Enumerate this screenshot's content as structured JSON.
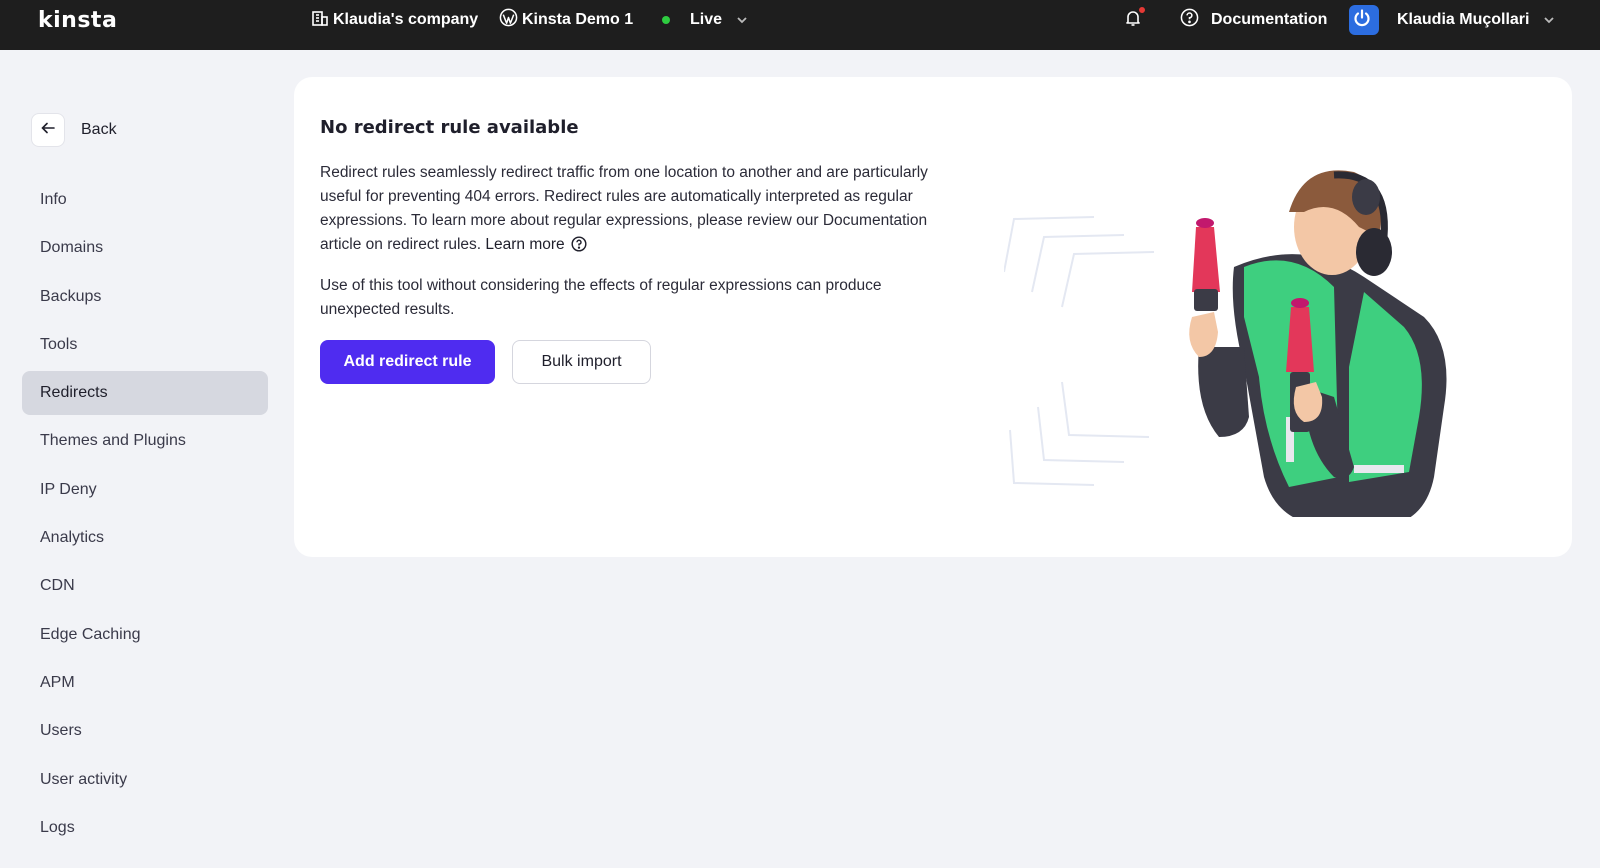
{
  "topbar": {
    "logo": "kinsta",
    "company": "Klaudia's company",
    "site": "Kinsta Demo 1",
    "environment": "Live",
    "environment_status_color": "#2ecc40",
    "documentation": "Documentation",
    "user_name": "Klaudia Muçollari",
    "icons": [
      "building-icon",
      "wordpress-icon",
      "chevron-down-icon",
      "bell-icon",
      "help-circle-icon",
      "power-icon"
    ]
  },
  "sidebar": {
    "back_label": "Back",
    "items": [
      {
        "label": "Info"
      },
      {
        "label": "Domains"
      },
      {
        "label": "Backups"
      },
      {
        "label": "Tools"
      },
      {
        "label": "Redirects",
        "active": true
      },
      {
        "label": "Themes and Plugins"
      },
      {
        "label": "IP Deny"
      },
      {
        "label": "Analytics"
      },
      {
        "label": "CDN"
      },
      {
        "label": "Edge Caching"
      },
      {
        "label": "APM"
      },
      {
        "label": "Users"
      },
      {
        "label": "User activity"
      },
      {
        "label": "Logs"
      }
    ]
  },
  "main": {
    "title": "No redirect rule available",
    "description": "Redirect rules seamlessly redirect traffic from one location to another and are particularly useful for preventing 404 errors. Redirect rules are automatically interpreted as regular expressions. To learn more about regular expressions, please review our Documentation article on redirect rules.",
    "learn_more": "Learn more",
    "warning": "Use of this tool without considering the effects of regular expressions can produce unexpected results.",
    "add_button": "Add redirect rule",
    "bulk_button": "Bulk import"
  },
  "colors": {
    "primary": "#4f2cf0",
    "topbar_bg": "#1e1e1e",
    "page_bg": "#f2f3f7",
    "notification_dot": "#e53935"
  }
}
